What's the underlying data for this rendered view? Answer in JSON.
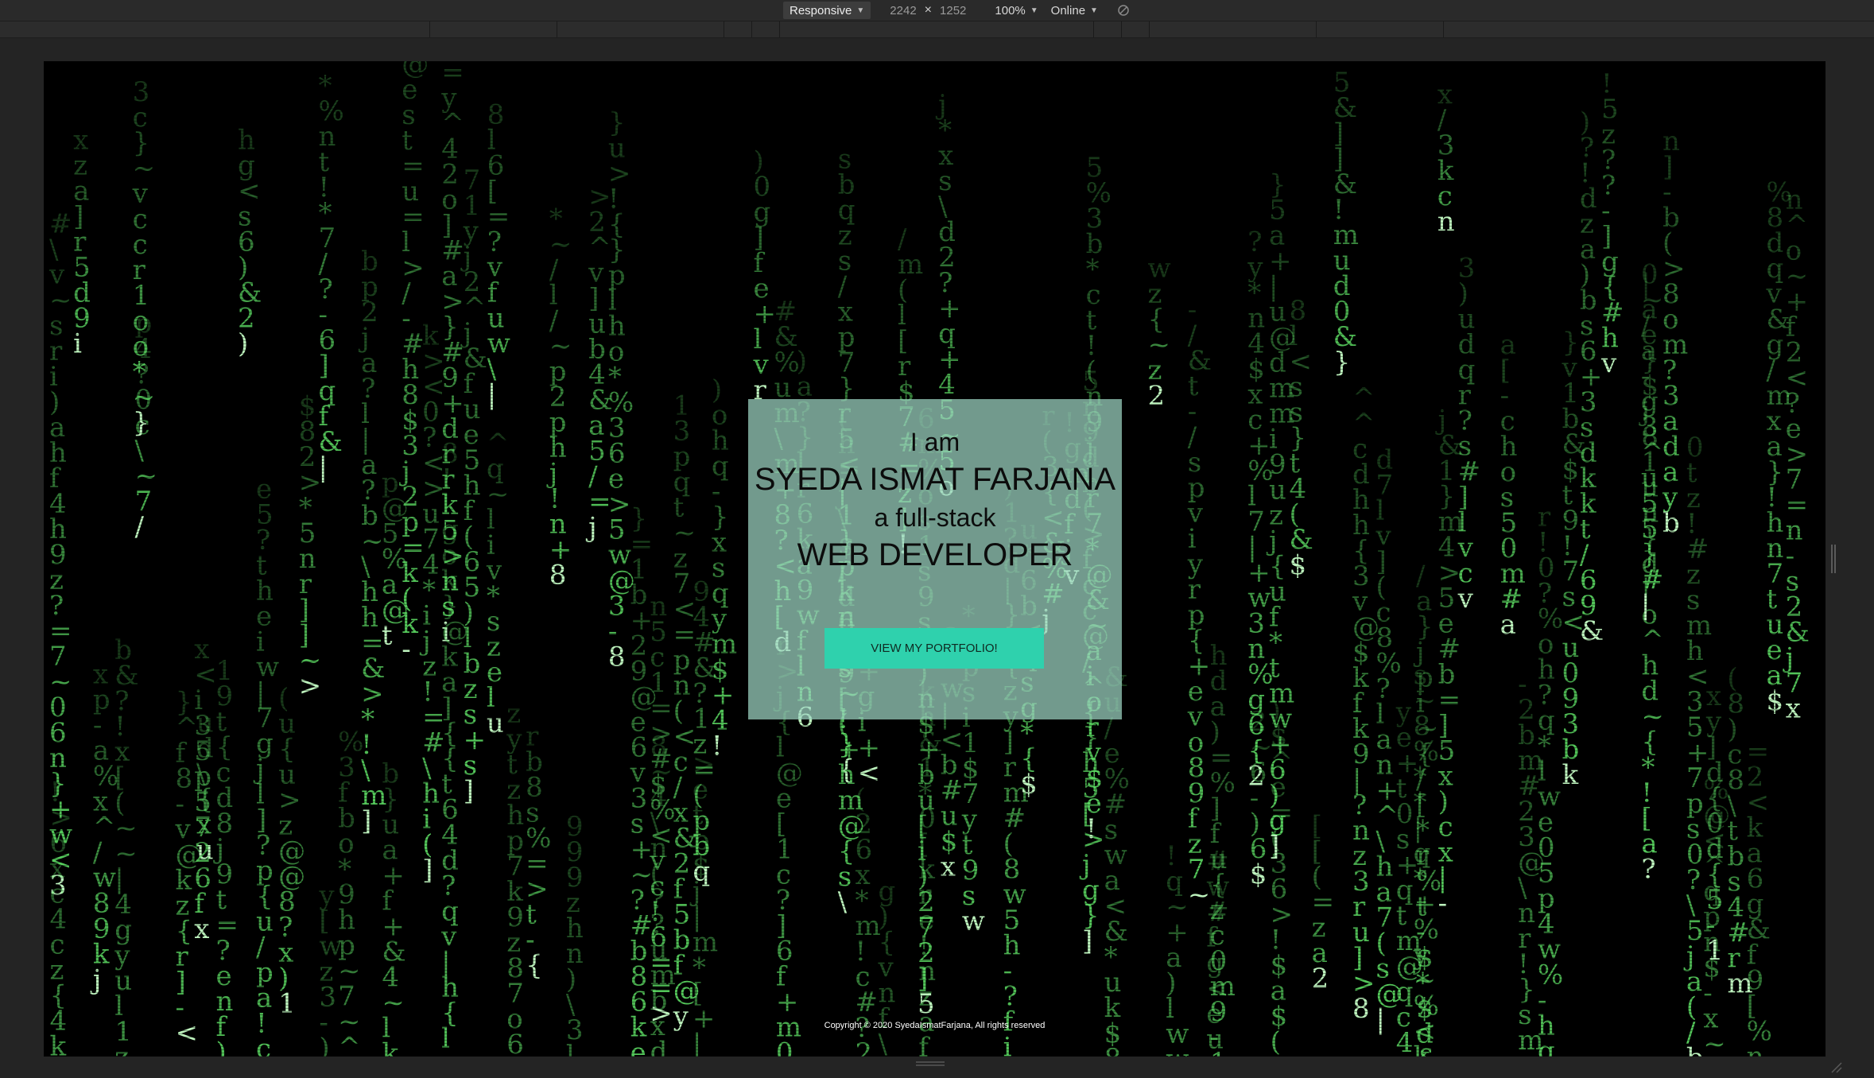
{
  "devtools": {
    "device_mode": "Responsive",
    "width": "2242",
    "times": "×",
    "height": "1252",
    "zoom": "100%",
    "network": "Online"
  },
  "hero": {
    "line1": "I am",
    "name": "SYEDA ISMAT FARJANA",
    "line3": "a full-stack",
    "role": "WEB DEVELOPER",
    "button": "VIEW MY PORTFOLIO!"
  },
  "footer": {
    "copyright": "Copyright © 2020 SyedaIsmatFarjana, All rights reserved"
  },
  "theme": {
    "rain_color": "#5fe066",
    "rain_head_color": "#c8ffc8",
    "hero_bg": "#9ed6c4",
    "button_color": "#2fd1ad"
  },
  "icons": {
    "rotate": "rotate-disabled-icon"
  }
}
